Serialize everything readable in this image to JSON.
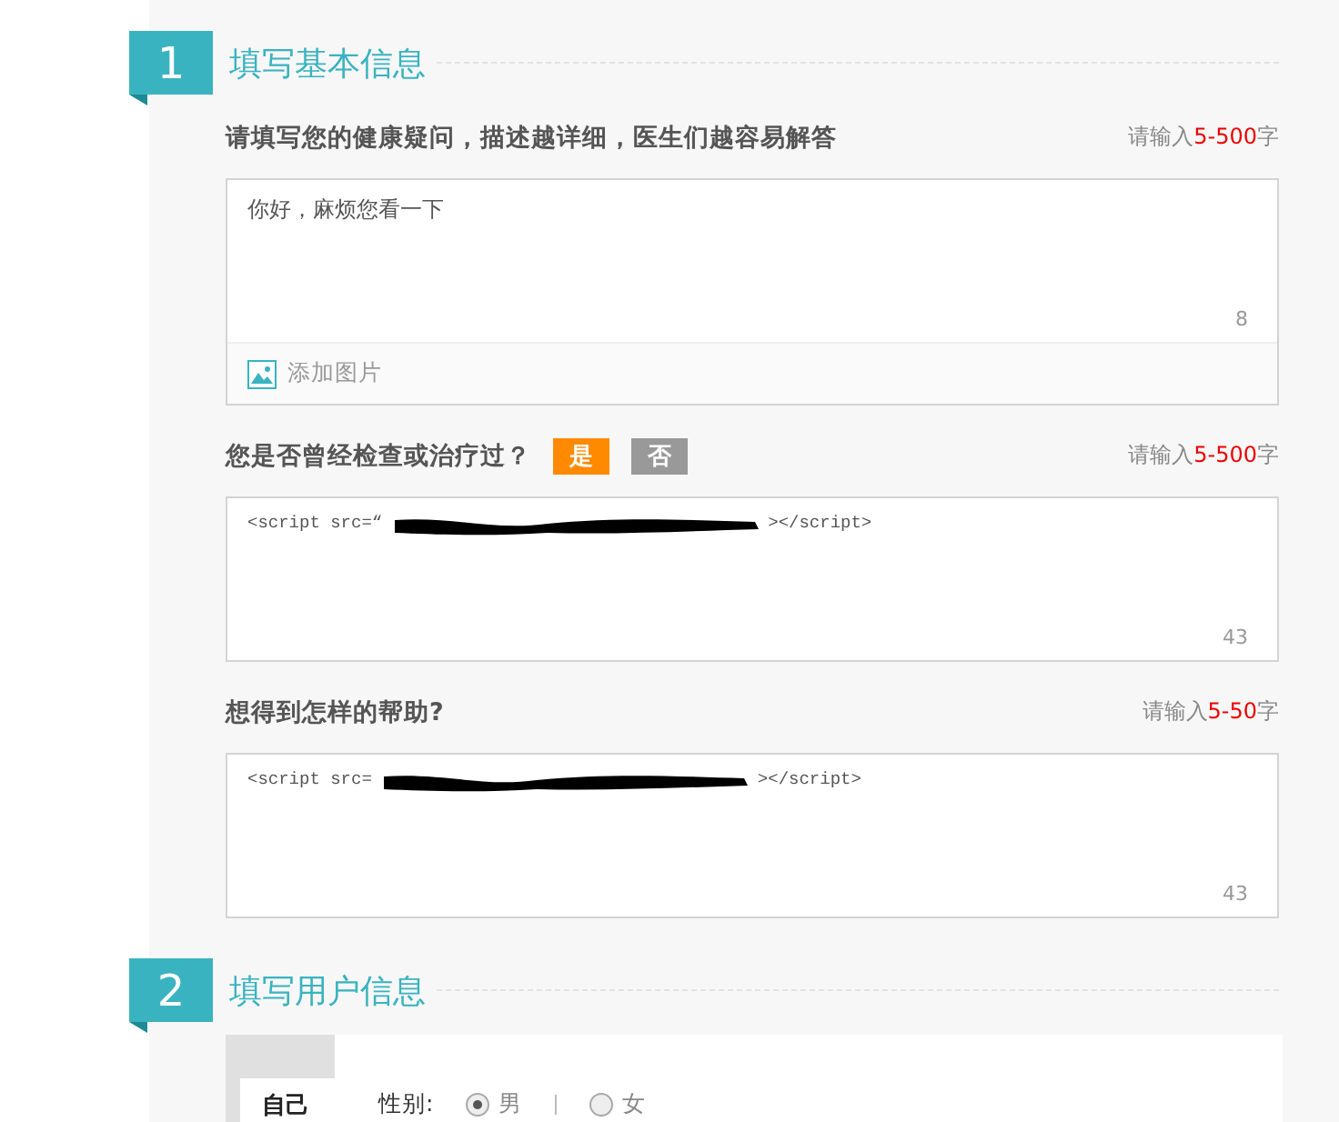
{
  "steps": [
    {
      "number": "1",
      "title": "填写基本信息"
    },
    {
      "number": "2",
      "title": "填写用户信息"
    }
  ],
  "questions": [
    {
      "label": "请填写您的健康疑问，描述越详细，医生们越容易解答",
      "hint_prefix": "请输入",
      "hint_range": "5-500",
      "hint_suffix": "字",
      "value_start": "你好，麻烦您看一下",
      "count": "8",
      "kind": "with-image",
      "add_image": "添加图片"
    },
    {
      "label": "您是否曾经检查或治疗过？",
      "hint_prefix": "请输入",
      "hint_range": "5-500",
      "hint_suffix": "字",
      "value_start": "<script src=“",
      "value_end": "></script>",
      "redacted": true,
      "count": "43",
      "kind": "with-choice",
      "choices": [
        {
          "label": "是",
          "selected": true
        },
        {
          "label": "否",
          "selected": false
        }
      ]
    },
    {
      "label": "想得到怎样的帮助?",
      "hint_prefix": "请输入",
      "hint_range": "5-50",
      "hint_suffix": "字",
      "value_start": "<script src=",
      "value_end": "></script>",
      "redacted": true,
      "count": "43",
      "kind": "plain"
    }
  ],
  "user": {
    "tab": "自己",
    "gender_label": "性别:",
    "genders": [
      {
        "label": "男",
        "selected": true
      },
      {
        "label": "女",
        "selected": false
      }
    ]
  }
}
